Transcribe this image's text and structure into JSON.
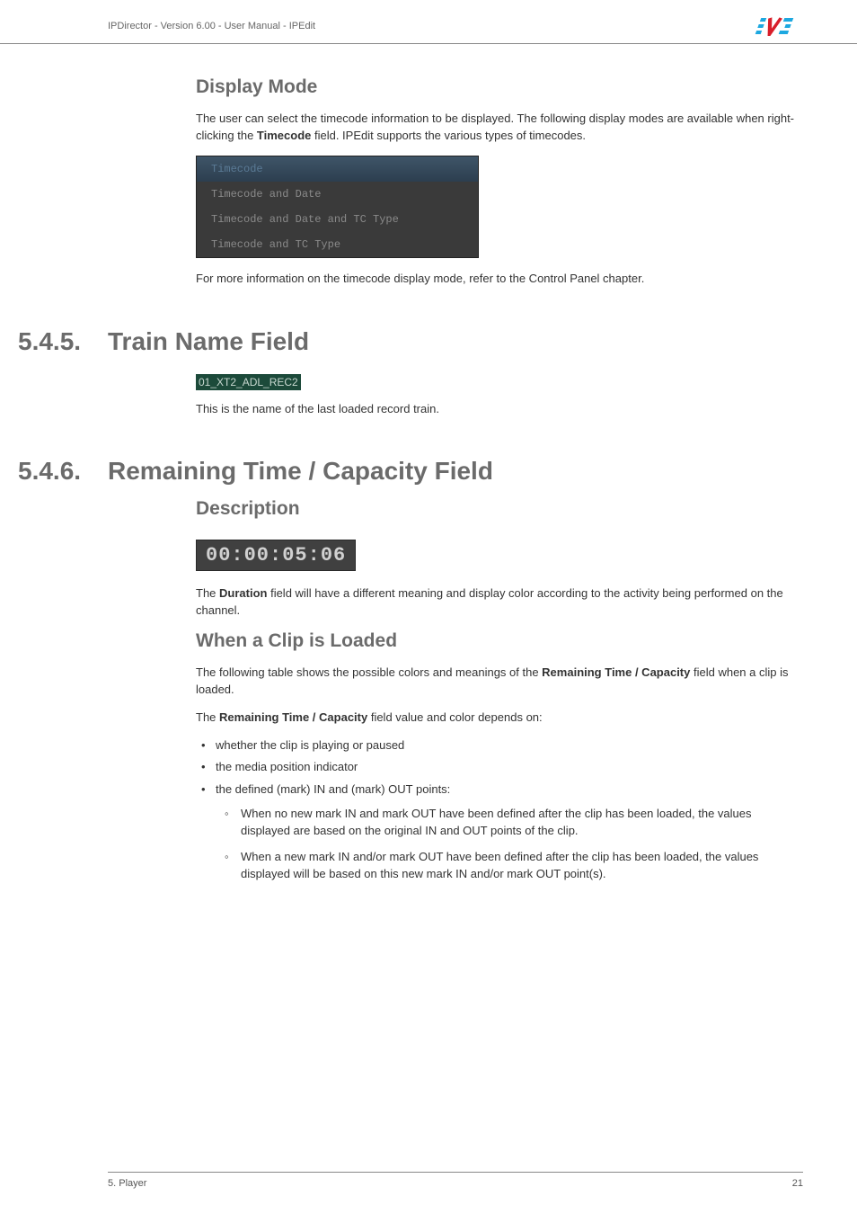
{
  "header": {
    "breadcrumb": "IPDirector - Version 6.00 - User Manual - IPEdit"
  },
  "s1": {
    "title": "Display Mode",
    "p1_a": "The user can select the timecode information to be displayed. The following display modes are available when right-clicking the ",
    "p1_b": "Timecode",
    "p1_c": " field. IPEdit supports the various types of timecodes.",
    "menu": {
      "i1": "Timecode",
      "i2": "Timecode and Date",
      "i3": "Timecode and Date and TC Type",
      "i4": "Timecode and TC Type"
    },
    "p2": "For more information on the timecode display mode, refer to the Control Panel chapter."
  },
  "s2": {
    "num": "5.4.5.",
    "title": "Train Name Field",
    "img_text": "01_XT2_ADL_REC2",
    "p1": "This is the name of the last loaded record train."
  },
  "s3": {
    "num": "5.4.6.",
    "title": "Remaining Time / Capacity Field",
    "h_desc": "Description",
    "img_text": "00:00:05:06",
    "p1_a": "The ",
    "p1_b": "Duration",
    "p1_c": " field will have a different meaning and display color according to the activity being performed on the channel.",
    "h_clip": "When a Clip is Loaded",
    "p2_a": "The following table shows the possible colors and meanings of the ",
    "p2_b": "Remaining Time / Capacity",
    "p2_c": " field when a clip is loaded.",
    "p3_a": "The ",
    "p3_b": "Remaining Time / Capacity",
    "p3_c": " field value and color depends on:",
    "b1": "whether the clip is playing or paused",
    "b2": "the media position indicator",
    "b3": "the defined (mark) IN and (mark) OUT points:",
    "sb1": "When no new mark IN and mark OUT have been defined after the clip has been loaded, the values displayed are based on the original IN and OUT points of the clip.",
    "sb2": "When a new mark IN and/or mark OUT have been defined after the clip has been loaded, the values displayed will be based on this new mark IN and/or mark OUT point(s)."
  },
  "footer": {
    "left": "5. Player",
    "right": "21"
  }
}
